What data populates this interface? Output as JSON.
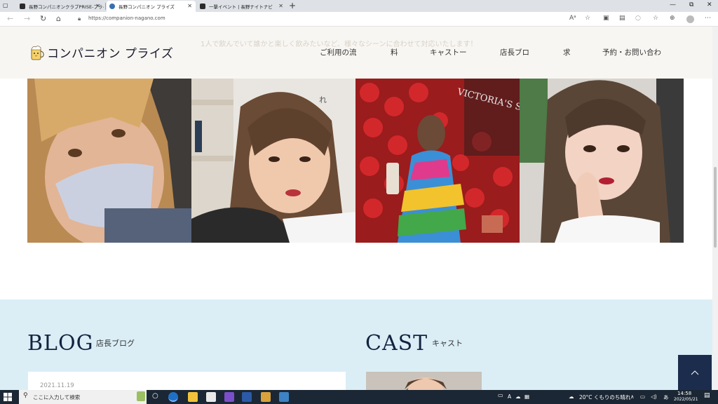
{
  "browser": {
    "tabs": [
      {
        "title": "長野コンパニオンクラブPRISE-プライズ",
        "active": false
      },
      {
        "title": "長野コンパニオン プライズ",
        "active": true
      },
      {
        "title": "一撃イベント | 長野ナイトナビ",
        "active": false
      }
    ],
    "url": "https://companion-nagano.com"
  },
  "site": {
    "tagline": "1人で飲んでいて誰かと楽しく飲みたいなど、様々なシーンに合わせて対応いたします！",
    "logo_text": "コンパニオン プライズ",
    "nav": [
      "ご利用の流",
      "料",
      "キャストー",
      "店長ブロ",
      "求",
      "予約・お問い合わ"
    ],
    "blog_title": "BLOG",
    "blog_sub": "店長ブログ",
    "blog_date": "2021.11.19",
    "cast_title": "CAST",
    "cast_sub": "キャスト",
    "photo_sign_text": "VICTORIA'S SECRET",
    "photo_bg_fragment": "れ"
  },
  "taskbar": {
    "search_placeholder": "ここに入力して検索",
    "weather": "20°C くもりのち晴れ",
    "ime": "A",
    "time": "14:58",
    "date": "2022/05/21"
  },
  "colors": {
    "header_bg": "#f8f6f1",
    "blue_section": "#dbeef6",
    "navy": "#1c2c4d",
    "taskbar": "#1b2734"
  }
}
